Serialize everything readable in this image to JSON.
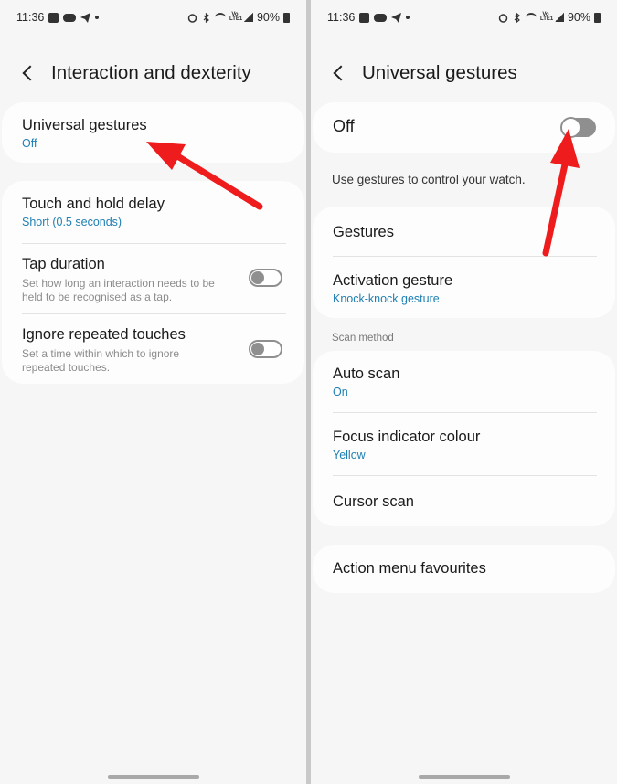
{
  "colors": {
    "accent_blue": "#1f7fb2",
    "annotation_red": "#ee1c1c",
    "toggle_off": "#8f8f8f"
  },
  "left": {
    "status": {
      "time": "11:36",
      "battery": "90%"
    },
    "header": {
      "title": "Interaction and dexterity"
    },
    "universal_gestures": {
      "title": "Universal gestures",
      "value": "Off"
    },
    "touch_hold": {
      "title": "Touch and hold delay",
      "value": "Short (0.5 seconds)"
    },
    "tap_duration": {
      "title": "Tap duration",
      "desc": "Set how long an interaction needs to be held to be recognised as a tap.",
      "toggle": false
    },
    "ignore_repeated": {
      "title": "Ignore repeated touches",
      "desc": "Set a time within which to ignore repeated touches.",
      "toggle": false
    }
  },
  "right": {
    "status": {
      "time": "11:36",
      "battery": "90%"
    },
    "header": {
      "title": "Universal gestures"
    },
    "master_switch": {
      "label": "Off",
      "toggle": false
    },
    "description": "Use gestures to control your watch.",
    "gestures": {
      "title": "Gestures"
    },
    "activation": {
      "title": "Activation gesture",
      "value": "Knock-knock gesture"
    },
    "scan_method_label": "Scan method",
    "auto_scan": {
      "title": "Auto scan",
      "value": "On"
    },
    "focus_colour": {
      "title": "Focus indicator colour",
      "value": "Yellow"
    },
    "cursor_scan": {
      "title": "Cursor scan"
    },
    "action_menu": {
      "title": "Action menu favourites"
    }
  }
}
